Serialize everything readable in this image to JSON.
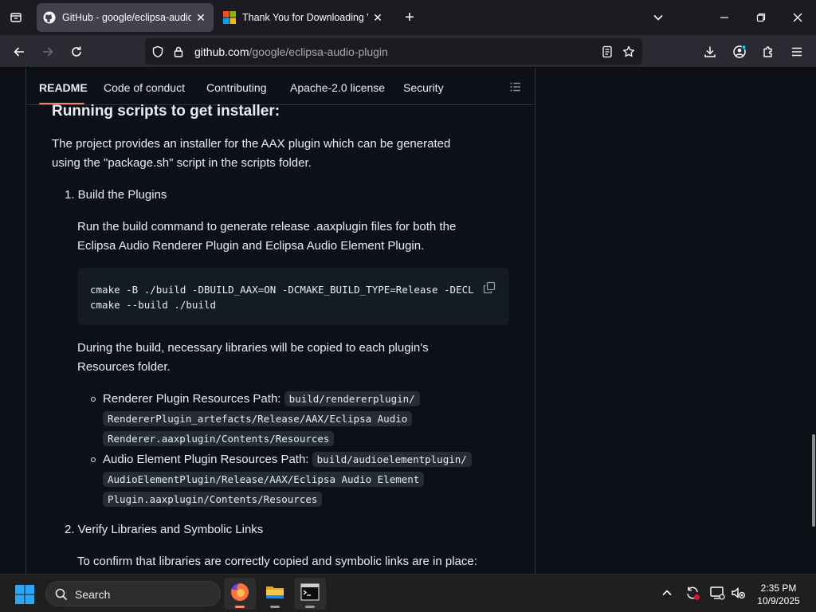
{
  "browser": {
    "tabs": [
      {
        "title": "GitHub - google/eclipsa-audio-",
        "active": true
      },
      {
        "title": "Thank You for Downloading Visu",
        "active": false
      }
    ],
    "url_host": "github.com",
    "url_path": "/google/eclipsa-audio-plugin"
  },
  "readme_nav": {
    "tabs": [
      "README",
      "Code of conduct",
      "Contributing",
      "Apache-2.0 license",
      "Security"
    ]
  },
  "content": {
    "heading": "Running scripts to get installer:",
    "intro_line1": "The project provides an installer for the AAX plugin which can be generated",
    "intro_line2": "using the \"package.sh\" script in the scripts folder.",
    "step1_title": "1. Build the Plugins",
    "step1_desc_line1": "Run the build command to generate release .aaxplugin files for both the",
    "step1_desc_line2": "Eclipsa Audio Renderer Plugin and Eclipsa Audio Element Plugin.",
    "code_line1": "cmake -B ./build -DBUILD_AAX=ON -DCMAKE_BUILD_TYPE=Release -DECLIPSA_",
    "code_line2": "cmake --build ./build",
    "during_line1": "During the build, necessary libraries will be copied to each plugin's",
    "during_line2": "Resources folder.",
    "bullet1_label": "Renderer Plugin Resources Path:",
    "bullet1_code1": "build/rendererplugin/",
    "bullet1_code2": "RendererPlugin_artefacts/Release/AAX/Eclipsa Audio",
    "bullet1_code3": "Renderer.aaxplugin/Contents/Resources",
    "bullet2_label": "Audio Element Plugin Resources Path:",
    "bullet2_code1": "build/audioelementplugin/",
    "bullet2_code2": "AudioElementPlugin/Release/AAX/Eclipsa Audio Element",
    "bullet2_code3": "Plugin.aaxplugin/Contents/Resources",
    "step2_title": "2. Verify Libraries and Symbolic Links",
    "step2_desc": "To confirm that libraries are correctly copied and symbolic links are in place:"
  },
  "taskbar": {
    "search_label": "Search",
    "time": "2:35 PM",
    "date": "10/9/2025"
  },
  "colors": {
    "accent_underline": "#f78166",
    "page_bg": "#0d1117",
    "code_bg": "#151b23"
  }
}
